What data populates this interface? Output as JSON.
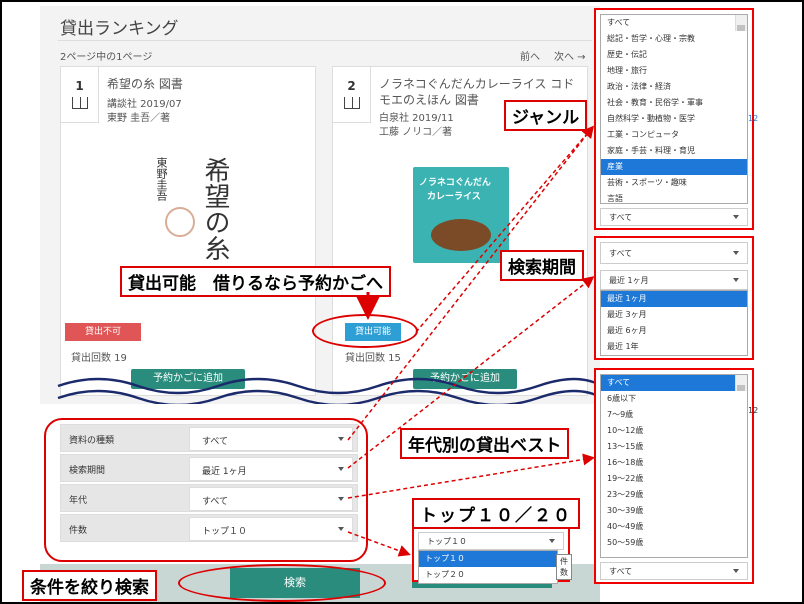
{
  "page": {
    "title": "貸出ランキング",
    "page_info": "2ページ中の1ページ",
    "prev": "前へ",
    "next": "次へ →"
  },
  "books": [
    {
      "rank": "1",
      "title": "希望の糸 図書",
      "publisher": "講談社 2019/07",
      "author": "東野 圭吾／著",
      "status": "貸出不可",
      "status_color": "#e05555",
      "count": "貸出回数 19",
      "reserve": "予約かごに追加",
      "cover_text": "希望の糸",
      "cover_author": "東野圭吾"
    },
    {
      "rank": "2",
      "title_line1": "ノラネコぐんだんカレーライス コド",
      "title_line2": "モエのえほん 図書",
      "publisher": "白泉社 2019/11",
      "author": "工藤 ノリコ／著",
      "status": "貸出可能",
      "status_color": "#2e9fd5",
      "count": "貸出回数 15",
      "reserve": "予約かごに追加",
      "cover_text": "ノラネコぐんだん",
      "cover_text2": "カレーライス"
    }
  ],
  "filters": [
    {
      "label": "資料の種類",
      "value": "すべて"
    },
    {
      "label": "検索期間",
      "value": "最近 1ヶ月"
    },
    {
      "label": "年代",
      "value": "すべて"
    },
    {
      "label": "件数",
      "value": "トップ１０"
    }
  ],
  "search_button": "検索",
  "callouts": {
    "available": "貸出可能　借りるなら予約かごへ",
    "genre": "ジャンル",
    "period": "検索期間",
    "age": "年代別の貸出ベスト",
    "top": "トップ１０／２０",
    "search": "条件を絞り検索"
  },
  "genre_options": [
    "すべて",
    "総記・哲学・心理・宗教",
    "歴史・伝記",
    "地理・旅行",
    "政治・法律・経済",
    "社会・教育・民俗学・軍事",
    "自然科学・動植物・医学",
    "工業・コンピュータ",
    "家庭・手芸・料理・育児",
    "産業",
    "芸術・スポーツ・趣味",
    "言語"
  ],
  "genre_selected": "産業",
  "genre_select_value": "すべて",
  "period_select_value": "すべて",
  "period_current": "最近 1ヶ月",
  "period_options": [
    "最近 1ヶ月",
    "最近 3ヶ月",
    "最近 6ヶ月",
    "最近 1年"
  ],
  "age_options": [
    "すべて",
    "6歳以下",
    "7〜9歳",
    "10〜12歳",
    "13〜15歳",
    "16〜18歳",
    "19〜22歳",
    "23〜29歳",
    "30〜39歳",
    "40〜49歳",
    "50〜59歳"
  ],
  "age_select_value": "すべて",
  "top_current": "トップ１０",
  "top_options": [
    "トップ１０",
    "トップ２０"
  ],
  "top_tooltip": "件数",
  "partial_label": "12",
  "colors": {
    "accent": "#2a8c7c",
    "callout_border": "#dd0000",
    "selected": "#1e78d7"
  }
}
